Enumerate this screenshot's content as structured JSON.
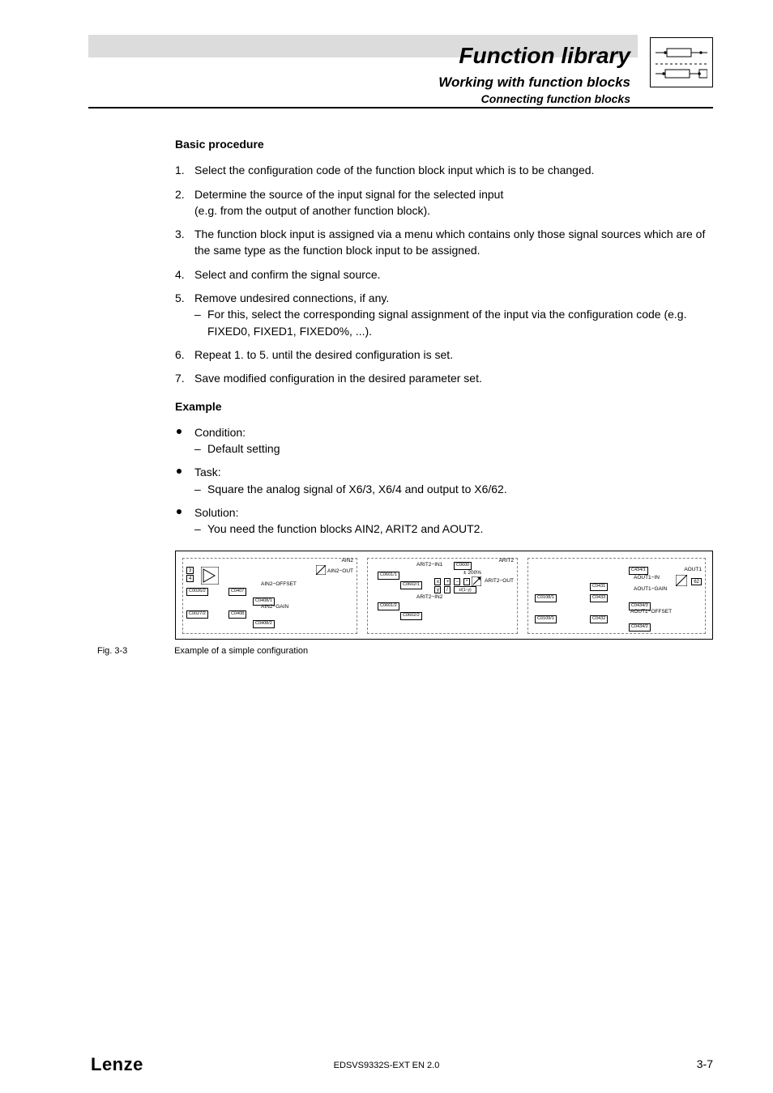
{
  "header": {
    "title": "Function library",
    "subtitle": "Working with function blocks",
    "subsubtitle": "Connecting function blocks"
  },
  "sections": {
    "basic_procedure_heading": "Basic procedure",
    "steps": [
      {
        "num": "1.",
        "text": "Select the configuration code of the function block input which is to be changed."
      },
      {
        "num": "2.",
        "text": "Determine the source of the input signal for the selected input",
        "text2": "(e.g. from the output of another function block)."
      },
      {
        "num": "3.",
        "text": "The function block input is assigned via a menu which contains only those signal sources which are of the same type as the function block input to be assigned."
      },
      {
        "num": "4.",
        "text": "Select and confirm the signal source."
      },
      {
        "num": "5.",
        "text": "Remove undesired connections, if any.",
        "sub": "For this, select the corresponding signal assignment of the input via the configuration code (e.g. FIXED0, FIXED1, FIXED0%, ...)."
      },
      {
        "num": "6.",
        "text": "Repeat 1. to 5. until the desired configuration is set."
      },
      {
        "num": "7.",
        "text": "Save modified configuration in the desired parameter set."
      }
    ],
    "example_heading": "Example",
    "example": {
      "condition_label": "Condition:",
      "condition_sub": "Default setting",
      "task_label": "Task:",
      "task_sub": "Square the analog signal of X6/3, X6/4 and output to X6/62.",
      "solution_label": "Solution:",
      "solution_sub": "You need the function blocks AIN2, ARIT2 and AOUT2."
    }
  },
  "diagram": {
    "block1": {
      "name": "AIN2",
      "out": "AIN2−OUT",
      "offset_label": "AIN2−OFFSET",
      "gain_label": "AIN2−GAIN",
      "pins": {
        "p3": "3",
        "p4": "4"
      },
      "codes": {
        "c1": "C0026/2",
        "c2": "C0407",
        "c3": "C0408/1",
        "c4": "C0027/2",
        "c5": "C0408",
        "c6": "C0408/2"
      }
    },
    "block2": {
      "name": "ARIT2",
      "in1": "ARIT2−IN1",
      "in2": "ARIT2−IN2",
      "mid": "C0600",
      "range": "± 200%",
      "out": "ARIT2−OUT",
      "ops": {
        "a": "+",
        "b": "−",
        "c": "*",
        "d": "x",
        "e": "y",
        "f": "/",
        "g": "x/(1−y)"
      },
      "codes": {
        "c1": "C0601/1",
        "c2": "C0602/1",
        "c3": "C0601/2",
        "c4": "C0602/2"
      }
    },
    "block3": {
      "name": "AOUT1",
      "in": "AOUT1−IN",
      "gain": "AOUT1−GAIN",
      "offset": "AOUT1−OFFSET",
      "pin62": "62",
      "codes": {
        "c1": "C434/1",
        "c2": "C0431",
        "c3": "C0108/1",
        "c4": "C0433",
        "c5": "C0434/3",
        "c6": "C0109/1",
        "c7": "C0432",
        "c8": "C0434/2"
      }
    }
  },
  "figure": {
    "number": "Fig. 3-3",
    "caption": "Example of a simple configuration"
  },
  "footer": {
    "brand": "Lenze",
    "doc_code": "EDSVS9332S-EXT EN 2.0",
    "page": "3-7"
  }
}
